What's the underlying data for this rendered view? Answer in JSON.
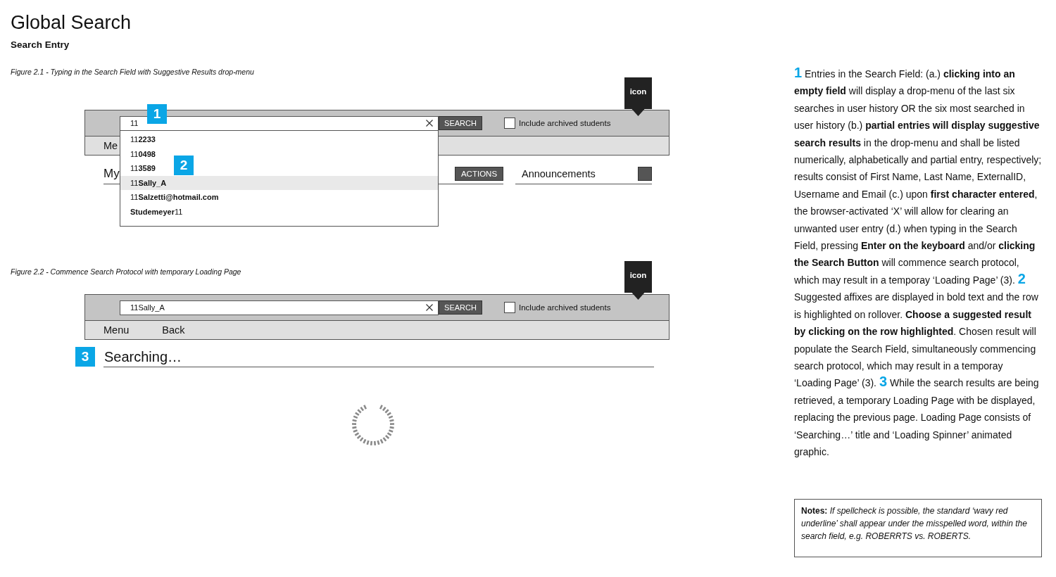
{
  "page": {
    "title": "Global Search",
    "subtitle": "Search Entry"
  },
  "figure_2_1": {
    "caption": "Figure 2.1 - Typing in the Search Field with Suggestive Results drop-menu",
    "tag": "icon",
    "search": {
      "value": "11",
      "button": "SEARCH"
    },
    "archived": {
      "label": "Include archived students",
      "checked": false
    },
    "nav": [
      "Me"
    ],
    "heading": "My",
    "actions_button": "ACTIONS",
    "announcements": "Announcements",
    "suggestions": [
      {
        "text": "11**2233**",
        "selected": false
      },
      {
        "text": "11**0498**",
        "selected": false
      },
      {
        "text": "11**3589**",
        "selected": false
      },
      {
        "text": "11**Sally_A**",
        "selected": true
      },
      {
        "text": "11**Salzetti@hotmail.com**",
        "selected": false
      },
      {
        "text": "**Studemeyer**11",
        "selected": false
      }
    ],
    "callouts": [
      "1",
      "2"
    ]
  },
  "figure_2_2": {
    "caption": "Figure 2.2 - Commence Search Protocol with temporary Loading Page",
    "tag": "icon",
    "search": {
      "value": "11Sally_A",
      "button": "SEARCH"
    },
    "archived": {
      "label": "Include archived students",
      "checked": false
    },
    "nav": [
      "Menu",
      "Back"
    ],
    "callout": "3",
    "heading": "Searching…"
  },
  "description": {
    "items": [
      {
        "number": "1",
        "text": "Entries in the Search Field: (a.) **clicking into an empty field** will display a drop-menu of the last six searches in user history OR the six most searched in user history (b.) **partial entries will display suggestive search results** in the drop-menu and shall be listed numerically, alphabetically and partial entry, respectively; results consist of First Name, Last Name, ExternalID, Username and Email (c.) upon **first character entered**, the browser-activated ‘X’ will allow for clearing an unwanted user entry (d.) when typing in the Search Field, pressing **Enter on the keyboard** and/or **clicking the Search Button** will commence search protocol, which may result in a temporay ‘Loading Page’ (3)."
      },
      {
        "number": "2",
        "text": "Suggested affixes are displayed in bold text and the row is highlighted on rollover. **Choose a suggested result by clicking on the row highlighted**. Chosen result will populate the Search Field, simultaneously commencing search protocol, which may result in a temporay ‘Loading Page’ (3)."
      },
      {
        "number": "3",
        "text": "While the search results are being retrieved, a temporary Loading Page with be displayed, replacing the previous page. Loading Page consists of ‘Searching…’ title and ‘Loading Spinner’ animated graphic."
      }
    ],
    "notes": "**Notes:** *If spellcheck is possible, the standard ‘wavy red underline’ shall appear under the misspelled word, within the search field, e.g. ROBERRTS vs. ROBERTS.*"
  }
}
